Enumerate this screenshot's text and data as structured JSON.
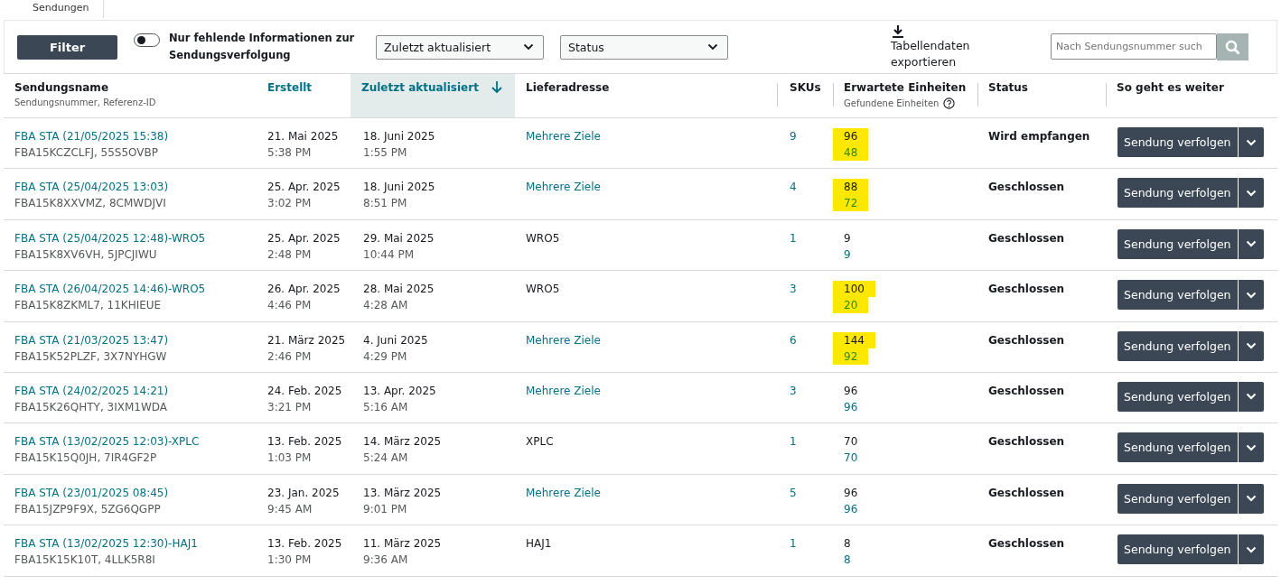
{
  "tab": {
    "label": "Sendungen"
  },
  "toolbar": {
    "filter_button": "Filter",
    "toggle": {
      "label": "Nur fehlende Informationen zur Sendungsverfolgung",
      "on": false
    },
    "sort_select": {
      "value": "Zuletzt aktualisiert"
    },
    "status_select": {
      "value": "Status"
    },
    "export": "Tabellendaten exportieren",
    "search": {
      "placeholder": "Nach Sendungsnummer such"
    }
  },
  "table": {
    "columns": [
      {
        "label": "Sendungsname",
        "sublabel": "Sendungsnummer, Referenz-ID",
        "sortable": false,
        "selected": false
      },
      {
        "label": "Erstellt",
        "sortable": true,
        "selected": false
      },
      {
        "label": "Zuletzt aktualisiert",
        "sortable": true,
        "selected": true
      },
      {
        "label": "Lieferadresse",
        "sortable": false,
        "selected": false
      },
      {
        "label": "SKUs",
        "sortable": false,
        "selected": false
      },
      {
        "label": "Erwartete Einheiten",
        "sublabel": "Gefundene Einheiten",
        "help": true,
        "sortable": false,
        "selected": false
      },
      {
        "label": "Status",
        "sortable": false,
        "selected": false
      },
      {
        "label": "So geht es weiter",
        "sortable": false,
        "selected": false
      }
    ],
    "rows": [
      {
        "name": "FBA STA (21/05/2025 15:38)",
        "ids": "FBA15KCZCLFJ, 55S5OVBP",
        "created_date": "21. Mai 2025",
        "created_time": "5:38 PM",
        "updated_date": "18. Juni 2025",
        "updated_time": "1:55 PM",
        "destination": "Mehrere Ziele",
        "destination_link": true,
        "skus": "9",
        "expected": "96",
        "found": "48",
        "highlighted": true,
        "status": "Wird empfangen",
        "action": "Sendung verfolgen"
      },
      {
        "name": "FBA STA (25/04/2025 13:03)",
        "ids": "FBA15K8XXVMZ, 8CMWDJVI",
        "created_date": "25. Apr. 2025",
        "created_time": "3:02 PM",
        "updated_date": "18. Juni 2025",
        "updated_time": "8:51 PM",
        "destination": "Mehrere Ziele",
        "destination_link": true,
        "skus": "4",
        "expected": "88",
        "found": "72",
        "highlighted": true,
        "status": "Geschlossen",
        "action": "Sendung verfolgen"
      },
      {
        "name": "FBA STA (25/04/2025 12:48)-WRO5",
        "ids": "FBA15K8XV6VH, 5JPCJIWU",
        "created_date": "25. Apr. 2025",
        "created_time": "2:48 PM",
        "updated_date": "29. Mai 2025",
        "updated_time": "10:44 PM",
        "destination": "WRO5",
        "destination_link": false,
        "skus": "1",
        "expected": "9",
        "found": "9",
        "highlighted": false,
        "status": "Geschlossen",
        "action": "Sendung verfolgen"
      },
      {
        "name": "FBA STA (26/04/2025 14:46)-WRO5",
        "ids": "FBA15K8ZKML7, 11KHIEUE",
        "created_date": "26. Apr. 2025",
        "created_time": "4:46 PM",
        "updated_date": "28. Mai 2025",
        "updated_time": "4:28 AM",
        "destination": "WRO5",
        "destination_link": false,
        "skus": "3",
        "expected": "100",
        "found": "20",
        "highlighted": true,
        "status": "Geschlossen",
        "action": "Sendung verfolgen"
      },
      {
        "name": "FBA STA (21/03/2025 13:47)",
        "ids": "FBA15K52PLZF, 3X7NYHGW",
        "created_date": "21. März 2025",
        "created_time": "2:46 PM",
        "updated_date": "4. Juni 2025",
        "updated_time": "4:29 PM",
        "destination": "Mehrere Ziele",
        "destination_link": true,
        "skus": "6",
        "expected": "144",
        "found": "92",
        "highlighted": true,
        "status": "Geschlossen",
        "action": "Sendung verfolgen"
      },
      {
        "name": "FBA STA (24/02/2025 14:21)",
        "ids": "FBA15K26QHTY, 3IXM1WDA",
        "created_date": "24. Feb. 2025",
        "created_time": "3:21 PM",
        "updated_date": "13. Apr. 2025",
        "updated_time": "5:16 AM",
        "destination": "Mehrere Ziele",
        "destination_link": true,
        "skus": "3",
        "expected": "96",
        "found": "96",
        "highlighted": false,
        "status": "Geschlossen",
        "action": "Sendung verfolgen"
      },
      {
        "name": "FBA STA (13/02/2025 12:03)-XPLC",
        "ids": "FBA15K15Q0JH, 7IR4GF2P",
        "created_date": "13. Feb. 2025",
        "created_time": "1:03 PM",
        "updated_date": "14. März 2025",
        "updated_time": "5:24 AM",
        "destination": "XPLC",
        "destination_link": false,
        "skus": "1",
        "expected": "70",
        "found": "70",
        "highlighted": false,
        "status": "Geschlossen",
        "action": "Sendung verfolgen"
      },
      {
        "name": "FBA STA (23/01/2025 08:45)",
        "ids": "FBA15JZP9F9X, 5ZG6QGPP",
        "created_date": "23. Jan. 2025",
        "created_time": "9:45 AM",
        "updated_date": "13. März 2025",
        "updated_time": "9:01 PM",
        "destination": "Mehrere Ziele",
        "destination_link": true,
        "skus": "5",
        "expected": "96",
        "found": "96",
        "highlighted": false,
        "status": "Geschlossen",
        "action": "Sendung verfolgen"
      },
      {
        "name": "FBA STA (13/02/2025 12:30)-HAJ1",
        "ids": "FBA15K15K10T, 4LLK5R8I",
        "created_date": "13. Feb. 2025",
        "created_time": "1:30 PM",
        "updated_date": "11. März 2025",
        "updated_time": "9:36 AM",
        "destination": "HAJ1",
        "destination_link": false,
        "skus": "1",
        "expected": "8",
        "found": "8",
        "highlighted": false,
        "status": "Geschlossen",
        "action": "Sendung verfolgen"
      }
    ]
  }
}
